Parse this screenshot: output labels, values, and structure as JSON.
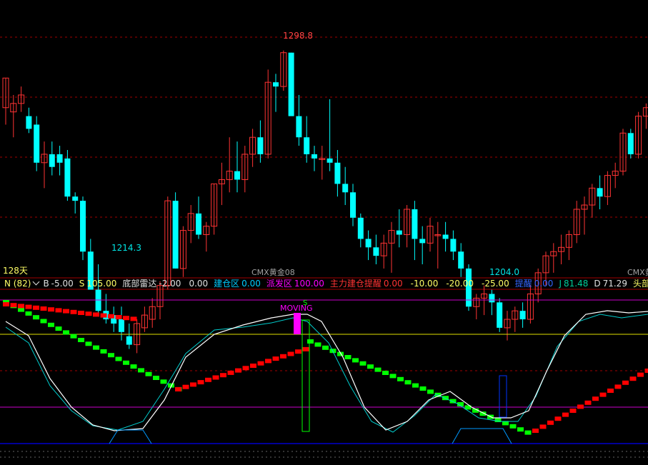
{
  "colors": {
    "up": "#ff3333",
    "down": "#00e5e5",
    "bear_box": "#00ffff",
    "grid": "#a00000",
    "sep": "#a00000",
    "white_line": "#ffffff",
    "cyan_line": "#00cccc",
    "yellow_line": "#e0e000",
    "magenta_line": "#cc00cc",
    "blue_line": "#0000cc",
    "green_block": "#00ff00",
    "red_block": "#ff0000",
    "text_white": "#e0e0e0",
    "text_yellow": "#ffff66",
    "text_cyan": "#00ccff",
    "text_magenta": "#ff00ff",
    "text_red": "#ff3333",
    "text_blue": "#3366ff",
    "text_j": "#00cc99"
  },
  "price_panel": {
    "high_label": "1298.8",
    "low_label_1": "1214.3",
    "low_label_2": "1204.0",
    "period_label": "128天",
    "contract_label": "CMX黄金08",
    "contract_label_cut": "CMX黄"
  },
  "indicator_bar": {
    "name": "N (82)",
    "items": [
      {
        "key": "B",
        "value": "-5.00",
        "color": "#e0e0e0"
      },
      {
        "key": "S",
        "value": "105.00",
        "color": "#ffff66"
      },
      {
        "key": "底部雷达",
        "value": "-2.00",
        "color": "#e0e0e0"
      },
      {
        "key": "",
        "value": "0.00",
        "color": "#e0e0e0"
      },
      {
        "key": "建仓区",
        "value": "0.00",
        "color": "#00ccff"
      },
      {
        "key": "派发区",
        "value": "100.00",
        "color": "#ff00ff"
      },
      {
        "key": "主力建仓提醒",
        "value": "0.00",
        "color": "#ff3333"
      },
      {
        "key": "",
        "value": "-10.00",
        "color": "#ffff66"
      },
      {
        "key": "",
        "value": "-20.00",
        "color": "#ffff66"
      },
      {
        "key": "",
        "value": "-25.00",
        "color": "#ffff66"
      },
      {
        "key": "提醒",
        "value": "0.00",
        "color": "#3366ff"
      },
      {
        "key": "J",
        "value": "81.48",
        "color": "#00cc99"
      },
      {
        "key": "D",
        "value": "71.29",
        "color": "#e0e0e0"
      },
      {
        "key": "头部线",
        "value": "",
        "color": "#ffff66"
      }
    ]
  },
  "indicator_panel": {
    "moving_label": "MOVING",
    "s_label": "S"
  },
  "chart_data": {
    "type": "candlestick",
    "ylim": [
      1198,
      1306
    ],
    "candles": [
      [
        1272,
        1286,
        1264,
        1286
      ],
      [
        1270,
        1278,
        1258,
        1274
      ],
      [
        1274,
        1282,
        1270,
        1278
      ],
      [
        1268,
        1272,
        1260,
        1262
      ],
      [
        1264,
        1268,
        1242,
        1246
      ],
      [
        1246,
        1256,
        1234,
        1250
      ],
      [
        1250,
        1256,
        1240,
        1244
      ],
      [
        1250,
        1254,
        1240,
        1246
      ],
      [
        1248,
        1252,
        1228,
        1230
      ],
      [
        1230,
        1232,
        1222,
        1228
      ],
      [
        1228,
        1230,
        1200,
        1204
      ],
      [
        1204,
        1210,
        1192,
        1186
      ],
      [
        1186,
        1198,
        1174,
        1176
      ],
      [
        1176,
        1184,
        1170,
        1172
      ],
      [
        1174,
        1178,
        1166,
        1170
      ],
      [
        1172,
        1178,
        1162,
        1166
      ],
      [
        1164,
        1170,
        1158,
        1160
      ],
      [
        1160,
        1172,
        1156,
        1170
      ],
      [
        1168,
        1178,
        1166,
        1174
      ],
      [
        1172,
        1182,
        1168,
        1178
      ],
      [
        1178,
        1190,
        1172,
        1188
      ],
      [
        1188,
        1230,
        1186,
        1228
      ],
      [
        1228,
        1232,
        1196,
        1196
      ],
      [
        1196,
        1216,
        1192,
        1214
      ],
      [
        1214,
        1226,
        1208,
        1222
      ],
      [
        1222,
        1230,
        1210,
        1212
      ],
      [
        1212,
        1218,
        1204,
        1216
      ],
      [
        1216,
        1236,
        1212,
        1236
      ],
      [
        1236,
        1246,
        1226,
        1238
      ],
      [
        1238,
        1258,
        1232,
        1242
      ],
      [
        1242,
        1256,
        1232,
        1238
      ],
      [
        1238,
        1254,
        1232,
        1250
      ],
      [
        1250,
        1262,
        1244,
        1258
      ],
      [
        1258,
        1266,
        1246,
        1250
      ],
      [
        1250,
        1290,
        1248,
        1284
      ],
      [
        1284,
        1288,
        1270,
        1282
      ],
      [
        1282,
        1299,
        1280,
        1298
      ],
      [
        1298,
        1298,
        1270,
        1268
      ],
      [
        1268,
        1278,
        1254,
        1258
      ],
      [
        1258,
        1268,
        1246,
        1250
      ],
      [
        1250,
        1254,
        1242,
        1248
      ],
      [
        1248,
        1254,
        1238,
        1248
      ],
      [
        1248,
        1276,
        1242,
        1246
      ],
      [
        1246,
        1252,
        1230,
        1236
      ],
      [
        1236,
        1244,
        1226,
        1232
      ],
      [
        1232,
        1236,
        1216,
        1220
      ],
      [
        1220,
        1222,
        1206,
        1210
      ],
      [
        1210,
        1214,
        1200,
        1206
      ],
      [
        1206,
        1212,
        1198,
        1202
      ],
      [
        1202,
        1212,
        1196,
        1208
      ],
      [
        1208,
        1218,
        1194,
        1214
      ],
      [
        1214,
        1224,
        1206,
        1212
      ],
      [
        1212,
        1226,
        1206,
        1224
      ],
      [
        1224,
        1228,
        1200,
        1210
      ],
      [
        1210,
        1216,
        1198,
        1208
      ],
      [
        1208,
        1220,
        1204,
        1216
      ],
      [
        1212,
        1218,
        1196,
        1212
      ],
      [
        1212,
        1218,
        1204,
        1210
      ],
      [
        1210,
        1214,
        1200,
        1204
      ],
      [
        1204,
        1208,
        1192,
        1196
      ],
      [
        1196,
        1198,
        1176,
        1178
      ],
      [
        1178,
        1184,
        1172,
        1182
      ],
      [
        1182,
        1188,
        1174,
        1184
      ],
      [
        1184,
        1186,
        1174,
        1180
      ],
      [
        1180,
        1182,
        1166,
        1168
      ],
      [
        1168,
        1176,
        1162,
        1172
      ],
      [
        1172,
        1178,
        1166,
        1176
      ],
      [
        1176,
        1180,
        1168,
        1172
      ],
      [
        1172,
        1188,
        1170,
        1184
      ],
      [
        1184,
        1196,
        1180,
        1194
      ],
      [
        1194,
        1204,
        1188,
        1202
      ],
      [
        1202,
        1208,
        1194,
        1204
      ],
      [
        1204,
        1212,
        1198,
        1206
      ],
      [
        1206,
        1214,
        1200,
        1212
      ],
      [
        1212,
        1228,
        1208,
        1224
      ],
      [
        1224,
        1230,
        1212,
        1226
      ],
      [
        1226,
        1236,
        1220,
        1234
      ],
      [
        1234,
        1240,
        1224,
        1230
      ],
      [
        1230,
        1242,
        1226,
        1240
      ],
      [
        1240,
        1246,
        1234,
        1242
      ],
      [
        1242,
        1262,
        1240,
        1260
      ],
      [
        1260,
        1262,
        1248,
        1250
      ],
      [
        1250,
        1270,
        1248,
        1268
      ],
      [
        1268,
        1274,
        1262,
        1272
      ]
    ]
  }
}
